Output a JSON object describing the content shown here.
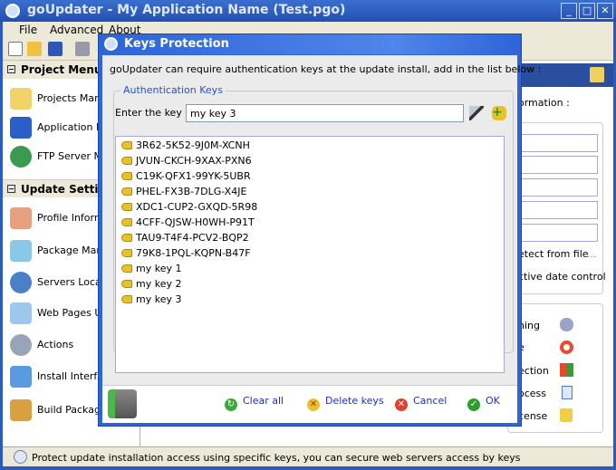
{
  "window": {
    "title": "goUpdater - My Application Name (Test.pgo)"
  },
  "menu": [
    "File",
    "Advanced",
    "About"
  ],
  "sidebar": {
    "project_menu": {
      "title": "Project Menu",
      "items": [
        "Projects Mana",
        "Application Pr",
        "FTP Server Ma"
      ]
    },
    "update_settings": {
      "title": "Update Settings",
      "items": [
        "Profile Informa",
        "Package Mana",
        "Servers Locat",
        "Web Pages Up",
        "Actions",
        "Install Interfac",
        "Build Package"
      ]
    }
  },
  "right": {
    "info_label": "ormation :",
    "detect": "etect from file",
    "detect_btn": "...",
    "date": "ctive date control",
    "items": [
      "ning",
      "e",
      "ection",
      "ocess",
      "cense"
    ]
  },
  "status": {
    "text": "Protect update installation access using specific keys, you can secure web servers access by keys"
  },
  "dialog": {
    "title": "Keys Protection",
    "description": "goUpdater can require authentication keys at the update install, add in the list below :",
    "group_label": "Authentication Keys",
    "enter_label": "Enter the key :",
    "key_value": "my key 3",
    "keys": [
      "3R62-5K52-9J0M-XCNH",
      "JVUN-CKCH-9XAX-PXN6",
      "C19K-QFX1-99YK-5UBR",
      "PHEL-FX3B-7DLG-X4JE",
      "XDC1-CUP2-GXQD-5R98",
      "4CFF-QJSW-H0WH-P91T",
      "TAU9-T4F4-PCV2-BQP2",
      "79K8-1PQL-KQPN-B47F",
      "my key 1",
      "my key 2",
      "my key 3"
    ],
    "buttons": {
      "clear": "Clear all",
      "delete": "Delete keys",
      "cancel": "Cancel",
      "ok": "OK"
    }
  },
  "colors": {
    "title_blue": "#2f66d6",
    "link_blue": "#1f2ec8",
    "group_blue": "#2950c8"
  }
}
